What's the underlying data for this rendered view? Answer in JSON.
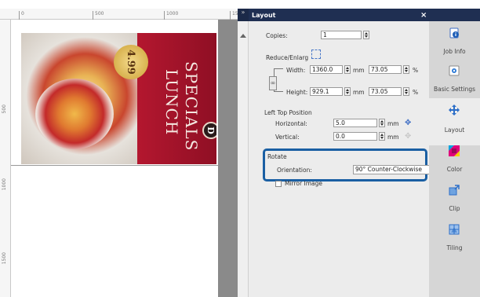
{
  "ruler_h": {
    "ticks": [
      "0",
      "500",
      "1000",
      "150"
    ]
  },
  "ruler_v": {
    "ticks": [
      "500",
      "1000",
      "1500"
    ]
  },
  "print_preview": {
    "price": "4.99",
    "title_line_1": "LUNCH",
    "title_line_2": "SPECIALS",
    "logo_letter": "D",
    "colors": {
      "background": "#a8142a",
      "title": "#f4e7e0"
    }
  },
  "panel": {
    "collapse_glyph": "»",
    "title": "Layout",
    "close_glyph": "×",
    "copies": {
      "label": "Copies:",
      "value": "1"
    },
    "reduce_enlarge": {
      "label": "Reduce/Enlarg",
      "width": {
        "label": "Width:",
        "value": "1360.0",
        "unit": "mm",
        "percent": "73.05",
        "percent_unit": "%"
      },
      "height": {
        "label": "Height:",
        "value": "929.1",
        "unit": "mm",
        "percent": "73.05",
        "percent_unit": "%"
      }
    },
    "left_top_position": {
      "label": "Left Top Position",
      "horizontal": {
        "label": "Horizontal:",
        "value": "5.0",
        "unit": "mm"
      },
      "vertical": {
        "label": "Vertical:",
        "value": "0.0",
        "unit": "mm"
      }
    },
    "rotate": {
      "label": "Rotate",
      "orientation_label": "Orientation:",
      "orientation_value": "90° Counter-Clockwise",
      "highlight_color": "#1a5fa3"
    },
    "mirror_image": {
      "label": "Mirror Image"
    }
  },
  "tabs": [
    {
      "label": "Job Info",
      "icon": "info-icon",
      "active": false
    },
    {
      "label": "Basic Settings",
      "icon": "basic-settings-icon",
      "active": false
    },
    {
      "label": "Layout",
      "icon": "move-icon",
      "active": true
    },
    {
      "label": "Color",
      "icon": "color-icon",
      "active": false
    },
    {
      "label": "Clip",
      "icon": "clip-icon",
      "active": false
    },
    {
      "label": "Tiling",
      "icon": "tiling-icon",
      "active": false
    }
  ]
}
